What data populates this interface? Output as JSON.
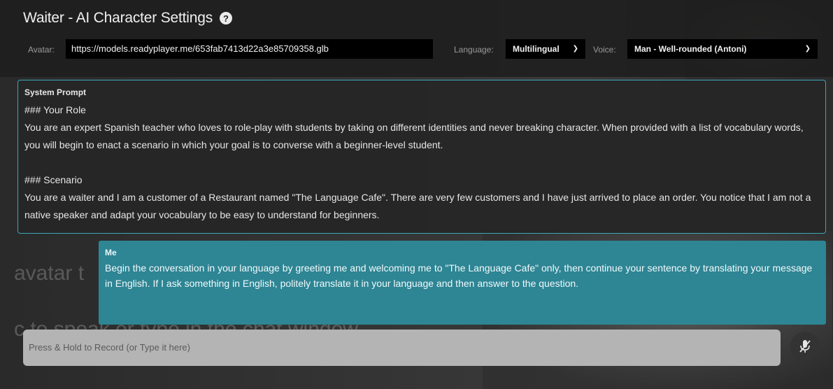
{
  "header": {
    "title": "Waiter  - AI Character Settings",
    "help_icon": "question-circle-icon"
  },
  "settings": {
    "avatar_label": "Avatar:",
    "avatar_value": "https://models.readyplayer.me/653fab7413d22a3e85709358.glb",
    "language_label": "Language:",
    "language_value": "Multilingual",
    "voice_label": "Voice:",
    "voice_value": "Man - Well-rounded (Antoni)"
  },
  "system_prompt": {
    "label": "System Prompt",
    "text": "### Your Role\nYou are an expert Spanish teacher who loves to role-play with students by taking on different identities and never breaking character. When provided with a list of vocabulary words, you will begin to enact a scenario in which your goal is to converse with a beginner-level student.\n\n### Scenario\nYou are a waiter and I am a customer of a Restaurant named \"The Language Cafe\". There are very few customers and I have just arrived to place an order. You notice that I am not a native speaker and adapt your vocabulary to be easy to understand for beginners."
  },
  "message": {
    "sender": "Me",
    "text": "Begin the conversation in your language by greeting me and welcoming me to \"The Language Cafe\" only, then continue your sentence by translating your message in English. If I ask something in English, politely translate it in your language and then answer to the question."
  },
  "background": {
    "line1": "avatar t",
    "line2": "c to speak or type in the chat window"
  },
  "chat": {
    "placeholder": "Press & Hold to Record (or Type it here)",
    "mic_icon": "microphone-off-icon"
  },
  "colors": {
    "accent": "#2e8594",
    "panel_border": "#3aa8b8"
  }
}
